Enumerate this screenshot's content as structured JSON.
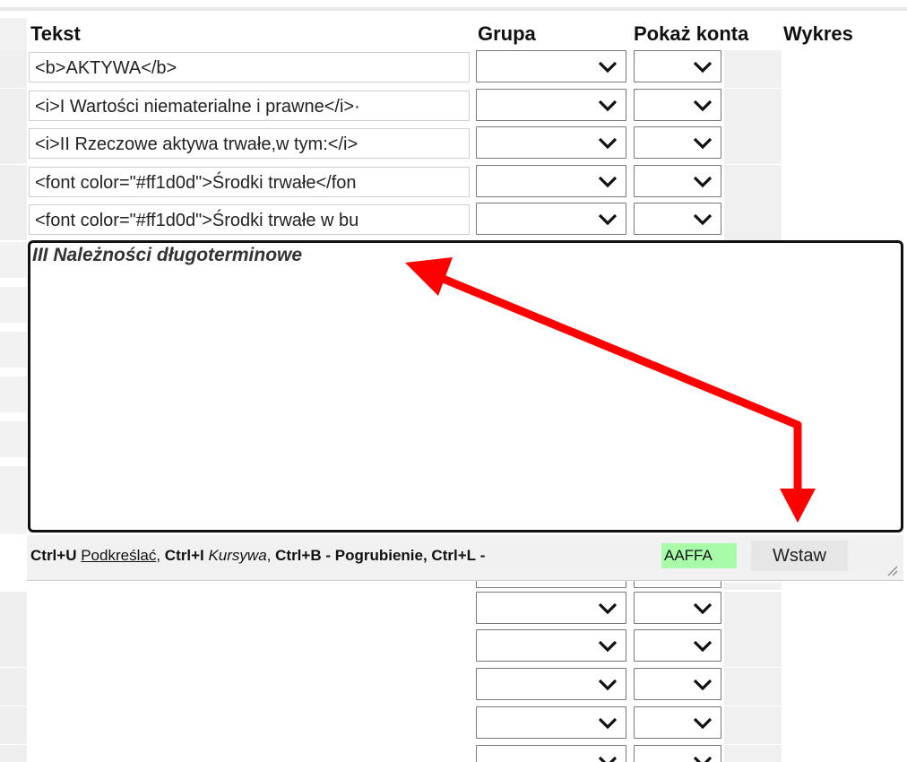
{
  "columns": {
    "tekst": "Tekst",
    "grupa": "Grupa",
    "pokaz_konta": "Pokaż konta",
    "wykres": "Wykres"
  },
  "rows": [
    {
      "text": "<b>AKTYWA</b>"
    },
    {
      "text": "<i>I Wartości niematerialne i prawne</i>·"
    },
    {
      "text": "<i>II Rzeczowe aktywa trwałe,w tym:</i>"
    },
    {
      "text": "<font color=\"#ff1d0d\">Środki trwałe</fon"
    },
    {
      "text": "<font color=\"#ff1d0d\">Środki trwałe w bu"
    }
  ],
  "editor": {
    "content": "III Należności długoterminowe"
  },
  "toolbar": {
    "ctrl_u": "Ctrl+U",
    "underline_label": "Podkreślać",
    "sep1": ",",
    "ctrl_i": "Ctrl+I",
    "italic_label": "Kursywa",
    "sep2": ",",
    "ctrl_b": "Ctrl+B",
    "bold_label": "- Pogrubienie,",
    "ctrl_l": "Ctrl+L",
    "dash": "-",
    "color_value": "AAFFA",
    "insert_label": "Wstaw"
  },
  "colors": {
    "arrow": "#ff0000",
    "swatch": "#a8fba8"
  }
}
